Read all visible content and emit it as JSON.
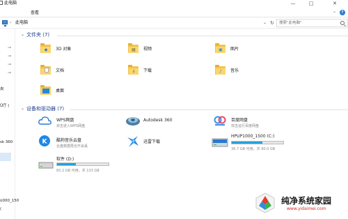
{
  "window": {
    "title": "此电脑",
    "minimize": "—",
    "maximize": "□",
    "close": "✕"
  },
  "ribbon": {
    "tabs": [
      "查看"
    ],
    "collapse": "⌄",
    "help": "?"
  },
  "address": {
    "back": "‹",
    "path": "此电脑",
    "sep": "›",
    "dropdown": "⌄",
    "refresh": "↻",
    "search_placeholder": "搜索\"此电脑\""
  },
  "nav": {
    "items": [
      "央",
      "Ū厅 (",
      "sk 360",
      "ü000_150",
      "("
    ]
  },
  "folders_section": {
    "title": "文件夹 (7)",
    "items": [
      {
        "label": "3D 对象",
        "icon": "3d-objects-icon"
      },
      {
        "label": "视频",
        "icon": "videos-icon"
      },
      {
        "label": "图片",
        "icon": "pictures-icon"
      },
      {
        "label": "文档",
        "icon": "documents-icon"
      },
      {
        "label": "下载",
        "icon": "downloads-icon"
      },
      {
        "label": "音乐",
        "icon": "music-icon"
      },
      {
        "label": "桌面",
        "icon": "desktop-icon"
      }
    ]
  },
  "devices_section": {
    "title": "设备和驱动器 (7)",
    "items": [
      {
        "name": "WPS网盘",
        "sub": "双击进入WPS网盘",
        "icon": "wps-cloud-icon"
      },
      {
        "name": "Autodesk 360",
        "sub": "",
        "icon": "autodesk-360-icon"
      },
      {
        "name": "百度网盘",
        "sub": "双击运行百度网盘",
        "icon": "baidu-netdisk-icon"
      },
      {
        "name": "酷狗音乐云盘",
        "sub": "云盘数据再也不会丢",
        "icon": "kugou-cloud-icon"
      },
      {
        "name": "迅雷下载",
        "sub": "",
        "icon": "xunlei-icon"
      },
      {
        "name": "HPUP1000_1500 (C:)",
        "sub": "36.7 GB 可用，共 90.0 GB",
        "icon": "drive-c-icon",
        "used_fraction": 0.59
      },
      {
        "name": "软件 (D:)",
        "sub": "83.2 GB 可用，共 133 GB",
        "icon": "drive-d-icon",
        "used_fraction": 0.37
      }
    ]
  },
  "watermark": {
    "title": "纯净系统家园",
    "url": "www.yidaimei.com"
  },
  "colors": {
    "accent": "#26a0da",
    "section_title": "#1e3f8c",
    "folder": "#f3c34c"
  }
}
